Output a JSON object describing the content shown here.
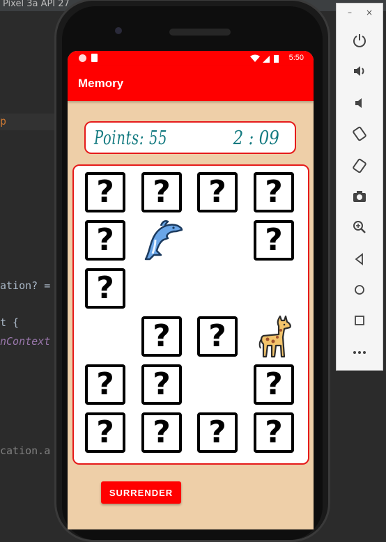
{
  "ide": {
    "tab_title": "Pixel 3a API 27",
    "code_fragments": [
      "p",
      "ation? =",
      "t {",
      "nContext",
      "cation.a"
    ]
  },
  "emulator": {
    "minimize_label": "–",
    "close_label": "×",
    "controls": [
      "power-icon",
      "volume-up-icon",
      "volume-down-icon",
      "rotate-left-icon",
      "rotate-right-icon",
      "camera-icon",
      "zoom-icon",
      "back-icon",
      "home-icon",
      "overview-icon",
      "more-icon"
    ]
  },
  "statusbar": {
    "time": "5:50"
  },
  "app": {
    "title": "Memory",
    "points_label": "Points: 55",
    "timer": "2 : 09",
    "surrender_label": "SURRENDER",
    "hidden_symbol": "?",
    "colors": {
      "primary": "#ff0000",
      "background": "#eecfa8",
      "accent_text": "#137a80"
    }
  },
  "board": {
    "columns": 4,
    "rows": 6,
    "cells": [
      [
        "hidden",
        "hidden",
        "hidden",
        "hidden"
      ],
      [
        "hidden",
        "dolphin",
        "empty",
        "hidden"
      ],
      [
        "hidden",
        "empty",
        "empty",
        "empty"
      ],
      [
        "empty",
        "hidden",
        "hidden",
        "giraffe"
      ],
      [
        "hidden",
        "hidden",
        "empty",
        "hidden"
      ],
      [
        "hidden",
        "hidden",
        "hidden",
        "hidden"
      ]
    ]
  }
}
